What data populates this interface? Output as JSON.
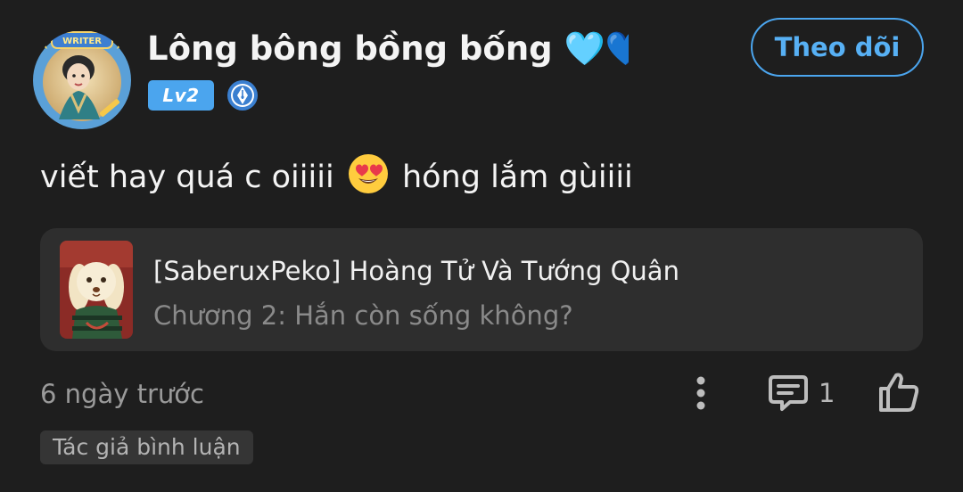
{
  "comment": {
    "user": {
      "name": "Lông bông bồng bống 🩵💙...",
      "level": "Lv2",
      "avatar_label": "WRITER",
      "avatar_icon": "writer-avatar",
      "badge_icon": "pen-nib-badge"
    },
    "follow_label": "Theo dõi",
    "text_before": "viết hay quá c oiiiii",
    "emoji": "heart-eyes-emoji",
    "text_after": "hóng lắm gùiiii",
    "story": {
      "title": "[SaberuxPeko] Hoàng Tử Và Tướng Quân",
      "chapter": "Chương 2: Hắn còn sống không?"
    },
    "timestamp": "6 ngày trước",
    "reply_count": "1",
    "author_tag": "Tác giả bình luận"
  },
  "colors": {
    "background": "#1e1e1e",
    "accent": "#4ba5ee",
    "card": "#2e2e2e",
    "muted_text": "#9a9a9a"
  }
}
